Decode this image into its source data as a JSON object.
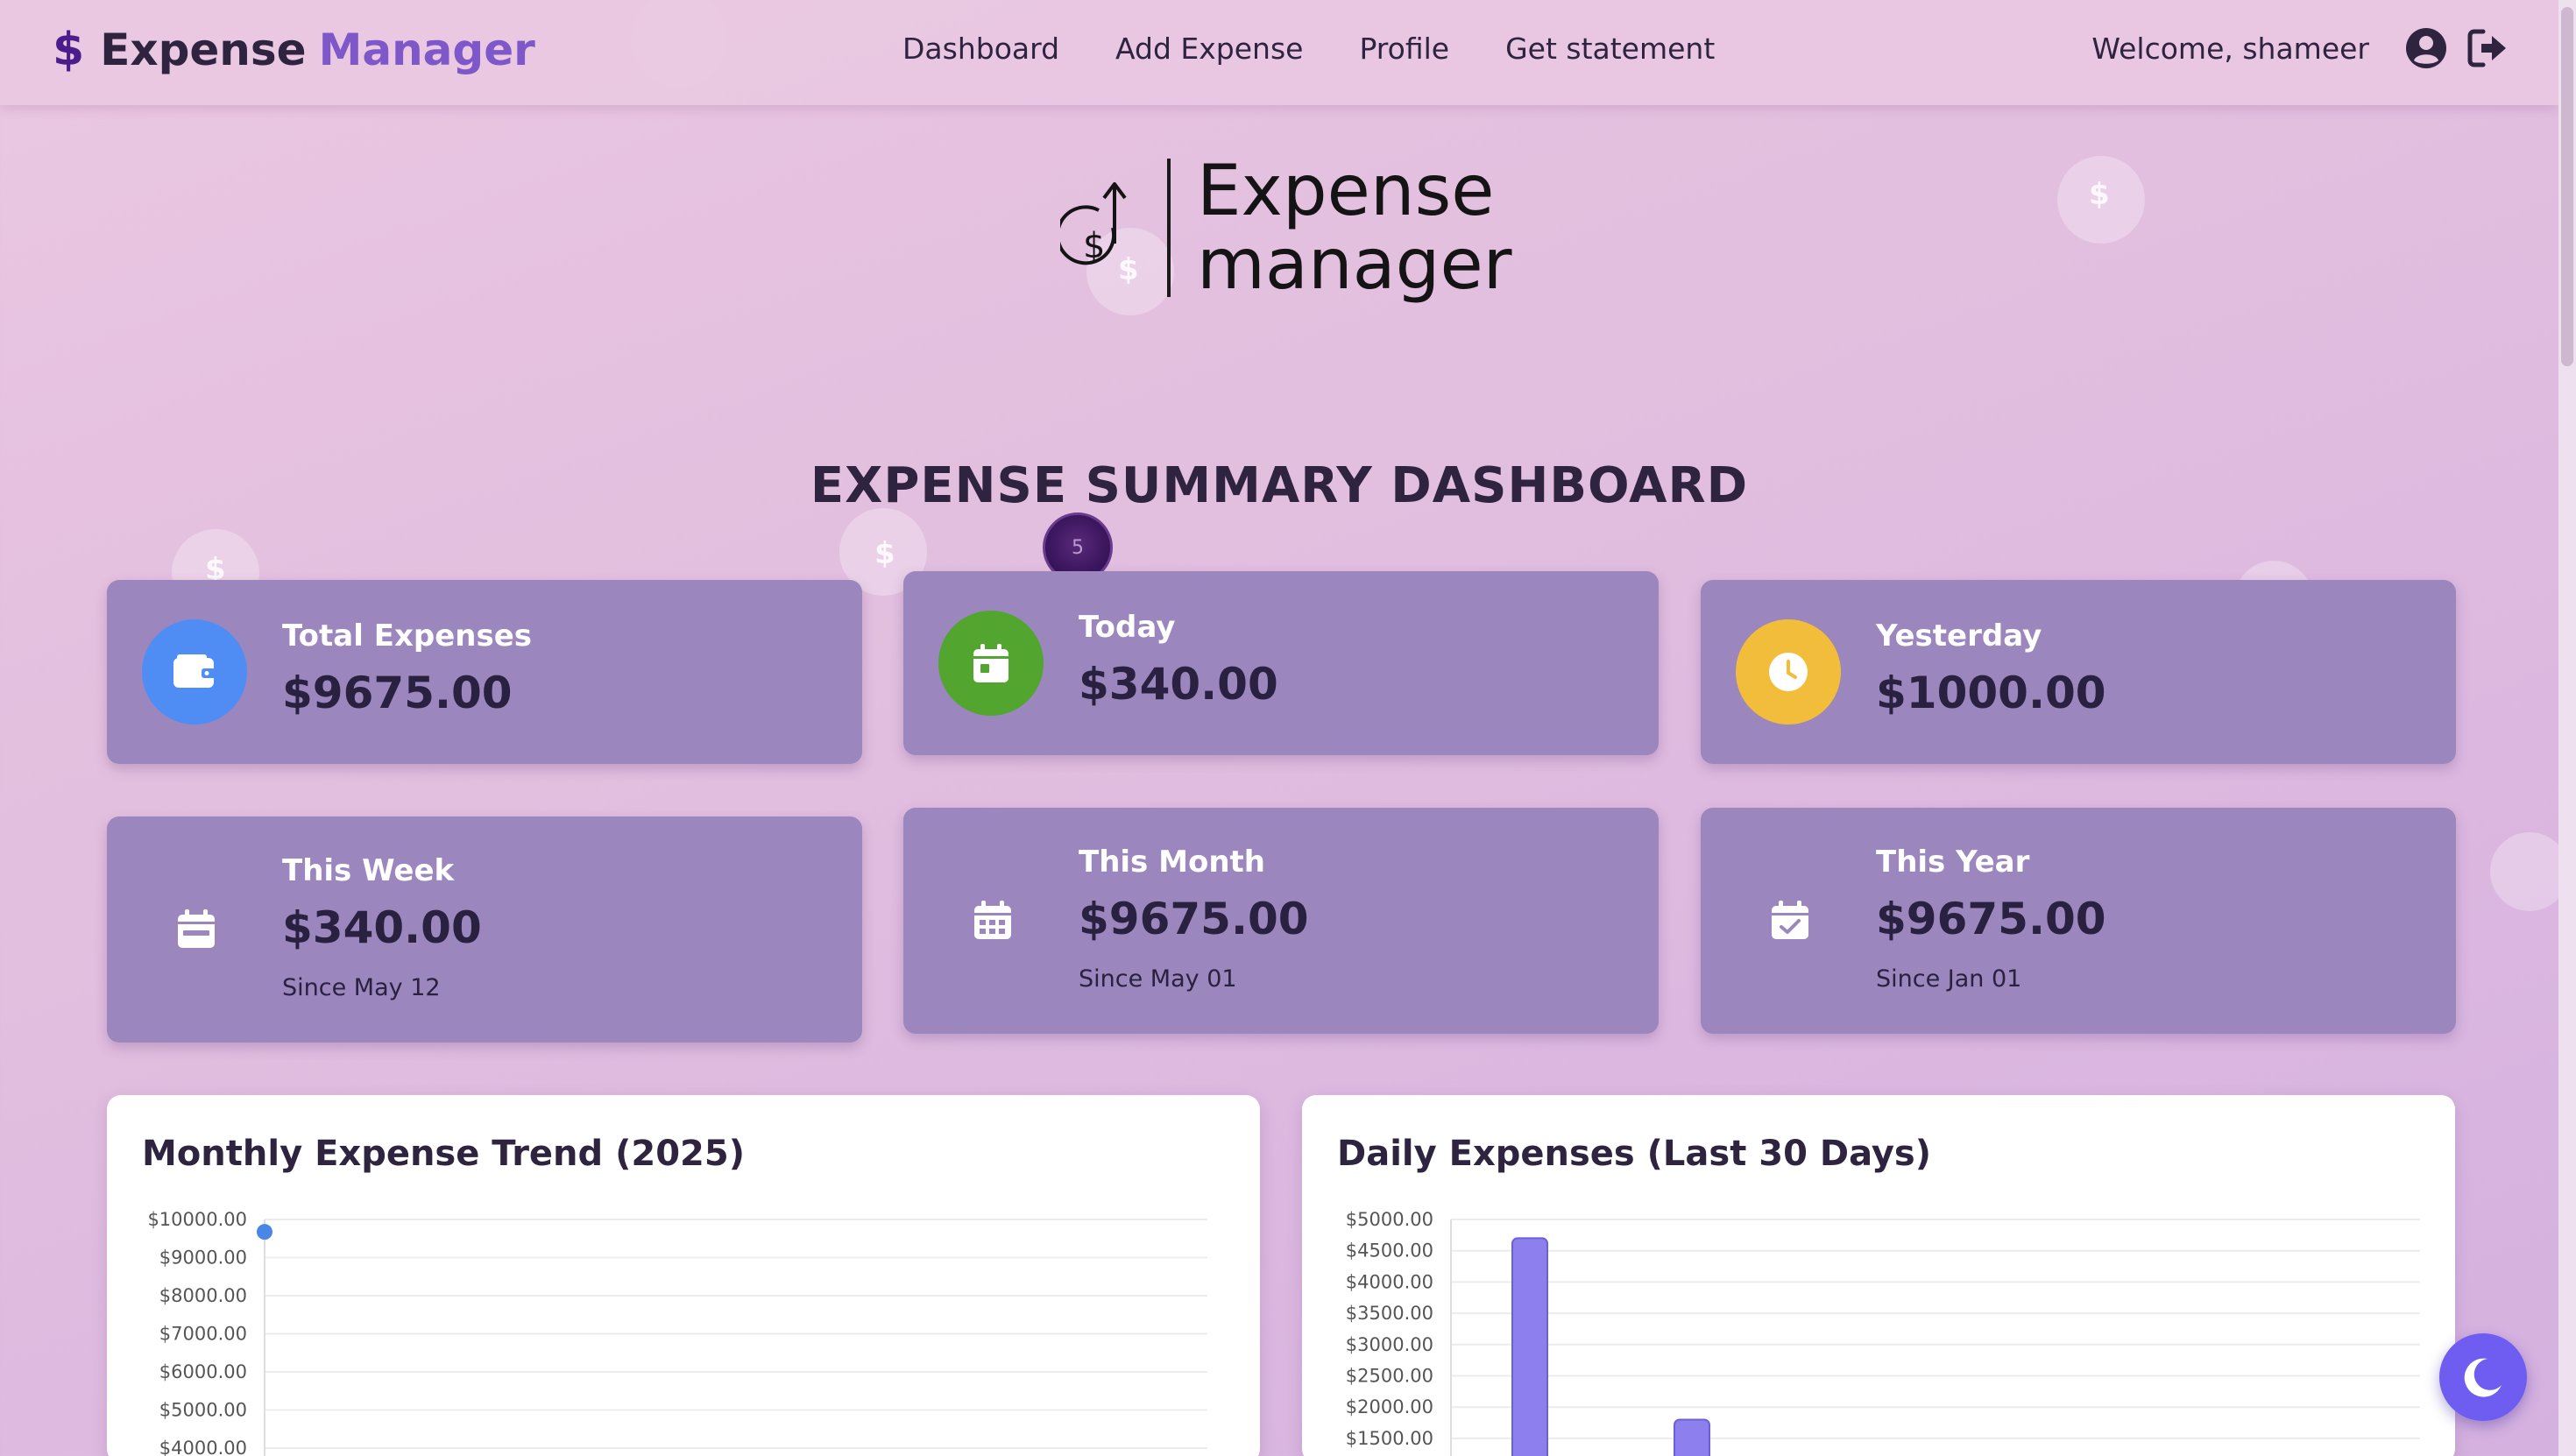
{
  "navbar": {
    "brand_icon": "$",
    "brand_word1": "Expense",
    "brand_word2": "Manager",
    "links": [
      {
        "label": "Dashboard"
      },
      {
        "label": "Add Expense"
      },
      {
        "label": "Profile"
      },
      {
        "label": "Get statement"
      }
    ],
    "welcome": "Welcome, shameer",
    "icons": [
      "user-circle-icon",
      "logout-icon"
    ]
  },
  "logo": {
    "line1": "Expense",
    "line2": "manager",
    "icon": "dollar-up-arrow-icon"
  },
  "page_title": "EXPENSE SUMMARY DASHBOARD",
  "cursor_badge": "5",
  "cards": [
    {
      "label": "Total Expenses",
      "value": "$9675.00",
      "since": "",
      "icon": "wallet-icon",
      "icon_bg": "#4f8df5"
    },
    {
      "label": "Today",
      "value": "$340.00",
      "since": "",
      "icon": "calendar-day-icon",
      "icon_bg": "#52a52e"
    },
    {
      "label": "Yesterday",
      "value": "$1000.00",
      "since": "",
      "icon": "clock-icon",
      "icon_bg": "#f2bd3a"
    },
    {
      "label": "This Week",
      "value": "$340.00",
      "since": "Since May 12",
      "icon": "calendar-week-icon"
    },
    {
      "label": "This Month",
      "value": "$9675.00",
      "since": "Since May 01",
      "icon": "calendar-month-icon"
    },
    {
      "label": "This Year",
      "value": "$9675.00",
      "since": "Since Jan 01",
      "icon": "calendar-check-icon"
    }
  ],
  "colors": {
    "card_bg": "#9b86bd",
    "accent": "#7e57c9",
    "bar_fill": "#8d80ee",
    "line_point": "#4a86e8",
    "toggle_bg": "#6f5cf0"
  },
  "chart_data": [
    {
      "type": "line",
      "title": "Monthly Expense Trend (2025)",
      "y_ticks": [
        "$10000.00",
        "$9000.00",
        "$8000.00",
        "$7000.00",
        "$6000.00",
        "$5000.00",
        "$4000.00"
      ],
      "ylim_visible": [
        4000,
        10000
      ],
      "series": [
        {
          "values": [
            9675
          ]
        }
      ],
      "grid": true
    },
    {
      "type": "bar",
      "title": "Daily Expenses (Last 30 Days)",
      "y_ticks": [
        "$5000.00",
        "$4500.00",
        "$4000.00",
        "$3500.00",
        "$3000.00",
        "$2500.00",
        "$2000.00",
        "$1500.00"
      ],
      "ylim_visible": [
        1500,
        5000
      ],
      "bars": [
        {
          "slot": 2,
          "value": 4700
        },
        {
          "slot": 7,
          "value": 1800
        }
      ],
      "slots": 30,
      "grid": true
    }
  ],
  "theme_toggle_icon": "moon-icon"
}
